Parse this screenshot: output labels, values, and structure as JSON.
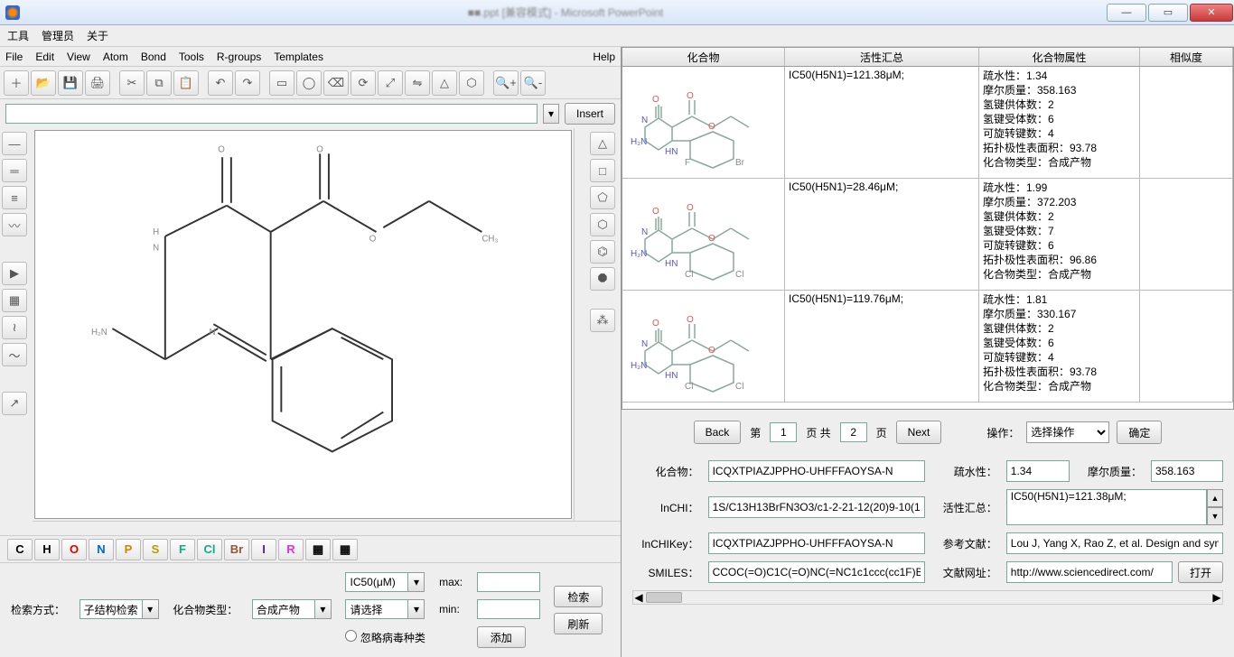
{
  "window": {
    "title_blur": "■■.ppt [兼容模式] - Microsoft PowerPoint"
  },
  "topmenu": {
    "tools": "工具",
    "admin": "管理员",
    "about": "关于"
  },
  "editor_menu": {
    "file": "File",
    "edit": "Edit",
    "view": "View",
    "atom": "Atom",
    "bond": "Bond",
    "tools": "Tools",
    "rgroups": "R-groups",
    "templates": "Templates",
    "help": "Help"
  },
  "insert_label": "Insert",
  "atom_buttons": [
    "C",
    "H",
    "O",
    "N",
    "P",
    "S",
    "F",
    "Cl",
    "Br",
    "I",
    "R"
  ],
  "toolbar_icons": [
    "new",
    "open",
    "save",
    "print",
    "cut",
    "copy",
    "paste",
    "undo",
    "redo",
    "select-rect",
    "select-lasso",
    "erase",
    "rotate",
    "zoom-fit",
    "reflect-h",
    "reflect-v",
    "clean",
    "zoom-in",
    "zoom-out"
  ],
  "left_tools": [
    "single",
    "double",
    "triple",
    "wavy",
    "arrow",
    "rev-arrow",
    "squiggle",
    "sine",
    "slash"
  ],
  "right_tools": [
    "triangle",
    "square",
    "pentagon",
    "hexagon",
    "benzene",
    "octagon",
    "rgroup"
  ],
  "search": {
    "method_label": "检索方式：",
    "method": "子结构检索",
    "ctype_label": "化合物类型：",
    "ctype": "合成产物",
    "ic50": "IC50(μM)",
    "max_label": "max:",
    "please": "请选择",
    "min_label": "min:",
    "ignore": "忽略病毒种类",
    "search_btn": "检索",
    "add_btn": "添加",
    "refresh_btn": "刷新"
  },
  "table_headers": {
    "compound": "化合物",
    "activity": "活性汇总",
    "props": "化合物属性",
    "sim": "相似度"
  },
  "rows": [
    {
      "activity": "IC50(H5N1)=121.38μM;",
      "props": [
        "疏水性：1.34",
        "摩尔质量：358.163",
        "氢键供体数：2",
        "氢键受体数：6",
        "可旋转键数：4",
        "拓扑极性表面积：93.78",
        "化合物类型：合成产物"
      ],
      "hal": [
        "F",
        "Br"
      ]
    },
    {
      "activity": "IC50(H5N1)=28.46μM;",
      "props": [
        "疏水性：1.99",
        "摩尔质量：372.203",
        "氢键供体数：2",
        "氢键受体数：7",
        "可旋转键数：6",
        "拓扑极性表面积：96.86",
        "化合物类型：合成产物"
      ],
      "hal": [
        "Cl",
        "Cl"
      ]
    },
    {
      "activity": "IC50(H5N1)=119.76μM;",
      "props": [
        "疏水性：1.81",
        "摩尔质量：330.167",
        "氢键供体数：2",
        "氢键受体数：6",
        "可旋转键数：4",
        "拓扑极性表面积：93.78",
        "化合物类型：合成产物"
      ],
      "hal": [
        "Cl",
        "Cl"
      ]
    }
  ],
  "pager": {
    "back": "Back",
    "di": "第",
    "page": "1",
    "ye_gong": "页 共",
    "total": "2",
    "ye": "页",
    "next": "Next",
    "op_label": "操作：",
    "op": "选择操作",
    "confirm": "确定"
  },
  "details": {
    "compound_label": "化合物：",
    "compound": "ICQXTPIAZJPPHO-UHFFFAOYSA-N",
    "logp_label": "疏水性：",
    "logp": "1.34",
    "mw_label": "摩尔质量：",
    "mw": "358.163",
    "inchi_label": "InCHI：",
    "inchi": "1S/C13H13BrFN3O3/c1-2-21-12(20)9-10(1",
    "activity_label": "活性汇总：",
    "activity": "IC50(H5N1)=121.38μM;",
    "inchikey_label": "InCHIKey：",
    "inchikey": "ICQXTPIAZJPPHO-UHFFFAOYSA-N",
    "ref_label": "参考文献：",
    "ref": "Lou J, Yang X, Rao Z, et al. Design and syn",
    "smiles_label": "SMILES：",
    "smiles": "CCOC(=O)C1C(=O)NC(=NC1c1ccc(cc1F)B",
    "url_label": "文献网址：",
    "url": "http://www.sciencedirect.com/",
    "open": "打开"
  }
}
